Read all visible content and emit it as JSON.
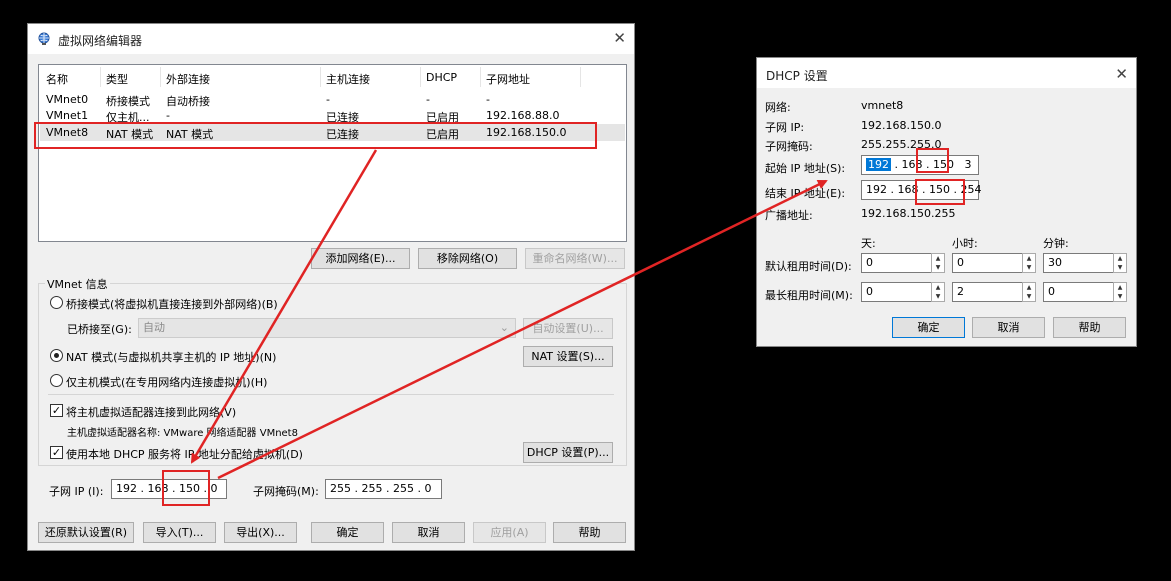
{
  "vne": {
    "title": "虚拟网络编辑器",
    "close": "✕",
    "columns": [
      "名称",
      "类型",
      "外部连接",
      "主机连接",
      "DHCP",
      "子网地址"
    ],
    "rows": [
      [
        "VMnet0",
        "桥接模式",
        "自动桥接",
        "-",
        "-",
        "-"
      ],
      [
        "VMnet1",
        "仅主机...",
        "-",
        "已连接",
        "已启用",
        "192.168.88.0"
      ],
      [
        "VMnet8",
        "NAT 模式",
        "NAT 模式",
        "已连接",
        "已启用",
        "192.168.150.0"
      ]
    ],
    "list_buttons": {
      "add": "添加网络(E)...",
      "remove": "移除网络(O)",
      "rename": "重命名网络(W)..."
    },
    "group_title": "VMnet 信息",
    "bridged_label": "桥接模式(将虚拟机直接连接到外部网络)(B)",
    "bridged_to_label": "已桥接至(G):",
    "bridged_to_value": "自动",
    "auto_settings": "自动设置(U)...",
    "nat_label": "NAT 模式(与虚拟机共享主机的 IP 地址)(N)",
    "nat_settings": "NAT 设置(S)...",
    "hostonly_label": "仅主机模式(在专用网络内连接虚拟机)(H)",
    "connect_adapter_label": "将主机虚拟适配器连接到此网络(V)",
    "adapter_name": "主机虚拟适配器名称: VMware 网络适配器 VMnet8",
    "use_dhcp_label": "使用本地 DHCP 服务将 IP 地址分配给虚拟机(D)",
    "dhcp_settings": "DHCP 设置(P)...",
    "subnet_ip_label": "子网 IP (I):",
    "subnet_ip_parts": [
      "192",
      "168",
      "150",
      "0"
    ],
    "subnet_mask_label": "子网掩码(M):",
    "subnet_mask_parts": [
      "255",
      "255",
      "255",
      "0"
    ],
    "footer_buttons": {
      "restore": "还原默认设置(R)",
      "import": "导入(T)...",
      "export": "导出(X)...",
      "ok": "确定",
      "cancel": "取消",
      "apply": "应用(A)",
      "help": "帮助"
    }
  },
  "dhcp": {
    "title": "DHCP 设置",
    "close": "✕",
    "network_label": "网络:",
    "network_value": "vmnet8",
    "subnet_ip_label": "子网 IP:",
    "subnet_ip_value": "192.168.150.0",
    "subnet_mask_label": "子网掩码:",
    "subnet_mask_value": "255.255.255.0",
    "start_ip_label": "起始 IP 地址(S):",
    "start_ip_parts": [
      "192",
      "168",
      "150",
      "3"
    ],
    "end_ip_label": "结束 IP 地址(E):",
    "end_ip_parts": [
      "192",
      "168",
      "150",
      "254"
    ],
    "broadcast_label": "广播地址:",
    "broadcast_value": "192.168.150.255",
    "col_days": "天:",
    "col_hours": "小时:",
    "col_minutes": "分钟:",
    "default_lease_label": "默认租用时间(D):",
    "default_lease_values": [
      "0",
      "0",
      "30"
    ],
    "max_lease_label": "最长租用时间(M):",
    "max_lease_values": [
      "0",
      "2",
      "0"
    ],
    "ok": "确定",
    "cancel": "取消",
    "help": "帮助"
  },
  "icons": {
    "app_icon": "globe-network-icon",
    "close_icon": "close-icon",
    "dropdown_icon": "chevron-down-icon"
  },
  "colors": {
    "annotation_red": "#e02424",
    "selection_blue": "#0078d7"
  }
}
